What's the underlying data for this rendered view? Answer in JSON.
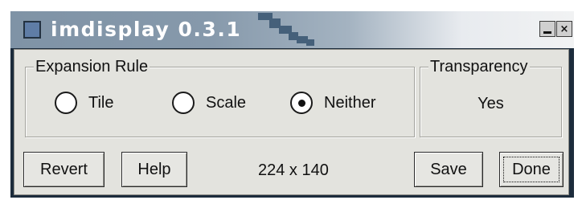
{
  "window": {
    "title": "imdisplay 0.3.1",
    "minimize_glyph": "",
    "close_glyph": "×"
  },
  "expansion_rule": {
    "legend": "Expansion Rule",
    "options": [
      {
        "label": "Tile",
        "selected": false
      },
      {
        "label": "Scale",
        "selected": false
      },
      {
        "label": "Neither",
        "selected": true
      }
    ]
  },
  "transparency": {
    "legend": "Transparency",
    "value": "Yes"
  },
  "buttons": {
    "revert": "Revert",
    "help": "Help",
    "save": "Save",
    "done": "Done"
  },
  "dimensions": "224 x 140",
  "icons": {
    "app": "app-window-icon",
    "minimize": "minimize-icon",
    "close": "close-icon"
  },
  "colors": {
    "titlebar_start": "#7f93a6",
    "titlebar_end": "#f1f2f3",
    "window_bg": "#e3e3de",
    "frame_border": "#1c2c3c"
  }
}
